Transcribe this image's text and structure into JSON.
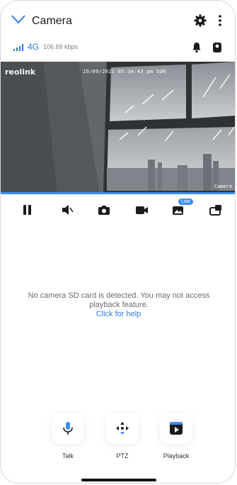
{
  "header": {
    "title": "Camera",
    "back_icon": "chevron-down-icon",
    "settings_icon": "gear-icon",
    "more_icon": "more-vertical-icon"
  },
  "status": {
    "network": "4G",
    "bitrate": "106.69 kbps",
    "signal_icon": "signal-bars-icon",
    "alarm_icon": "alarm-bell-icon",
    "device_icon": "camera-device-icon"
  },
  "video": {
    "logo": "reolink",
    "timestamp": "19/09/2021 05:34:43 pm SUN",
    "camera_name": "Camera",
    "progress": 1.0
  },
  "toolbar": {
    "items": [
      {
        "icon": "pause-icon"
      },
      {
        "icon": "speaker-mute-icon"
      },
      {
        "icon": "snapshot-camera-icon"
      },
      {
        "icon": "record-video-icon"
      },
      {
        "icon": "quality-image-icon",
        "badge": "Low"
      },
      {
        "icon": "picture-in-picture-icon"
      }
    ]
  },
  "message": {
    "text": "No camera SD card is detected. You may not access playback feature.",
    "help": "Click for help"
  },
  "actions": [
    {
      "label": "Talk",
      "icon": "microphone-icon"
    },
    {
      "label": "PTZ",
      "icon": "ptz-arrows-icon"
    },
    {
      "label": "Playback",
      "icon": "play-square-icon"
    }
  ],
  "colors": {
    "accent": "#3c8df0",
    "link": "#2d7be4"
  }
}
